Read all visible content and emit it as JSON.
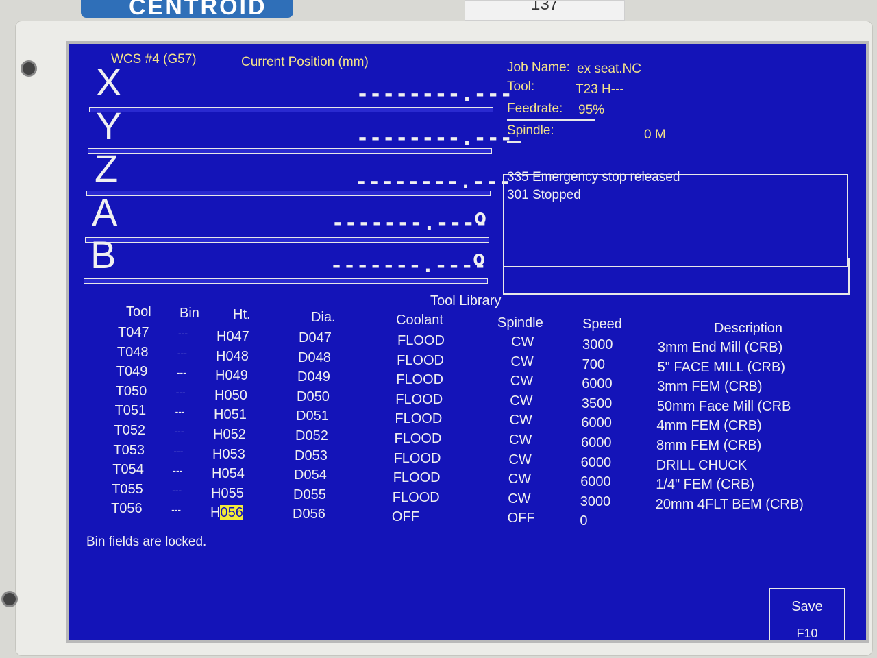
{
  "brand": {
    "logo_text": "CENTROID",
    "tag_text": "137"
  },
  "header": {
    "wcs": "WCS #4 (G57)",
    "position_title": "Current Position (mm)",
    "job_label": "Job Name:",
    "job_value": "ex seat.NC",
    "tool_label": "Tool:",
    "tool_value": "T23 H---",
    "feed_label": "Feedrate:",
    "feed_value": "95%",
    "spindle_label": "Spindle:",
    "spindle_value": "0 M"
  },
  "axes": [
    {
      "letter": "X",
      "value": "--------.---",
      "unit": ""
    },
    {
      "letter": "Y",
      "value": "--------.---",
      "unit": ""
    },
    {
      "letter": "Z",
      "value": "--------.---",
      "unit": ""
    },
    {
      "letter": "A",
      "value": "-------.----",
      "unit": "o"
    },
    {
      "letter": "B",
      "value": "-------.----",
      "unit": "o"
    }
  ],
  "messages": [
    "335 Emergency stop released",
    "301 Stopped"
  ],
  "library": {
    "title": "Tool Library",
    "columns": [
      "Tool",
      "Bin",
      "Ht.",
      "Dia.",
      "Coolant",
      "Spindle",
      "Speed",
      "Description"
    ],
    "rows": [
      [
        "T047",
        "---",
        "H047",
        "D047",
        "FLOOD",
        "CW",
        "3000",
        "3mm End Mill (CRB)"
      ],
      [
        "T048",
        "---",
        "H048",
        "D048",
        "FLOOD",
        "CW",
        "700",
        "5\" FACE MILL (CRB)"
      ],
      [
        "T049",
        "---",
        "H049",
        "D049",
        "FLOOD",
        "CW",
        "6000",
        "3mm FEM (CRB)"
      ],
      [
        "T050",
        "---",
        "H050",
        "D050",
        "FLOOD",
        "CW",
        "3500",
        "50mm Face Mill (CRB"
      ],
      [
        "T051",
        "---",
        "H051",
        "D051",
        "FLOOD",
        "CW",
        "6000",
        "4mm FEM (CRB)"
      ],
      [
        "T052",
        "---",
        "H052",
        "D052",
        "FLOOD",
        "CW",
        "6000",
        "8mm FEM (CRB)"
      ],
      [
        "T053",
        "---",
        "H053",
        "D053",
        "FLOOD",
        "CW",
        "6000",
        "DRILL CHUCK"
      ],
      [
        "T054",
        "---",
        "H054",
        "D054",
        "FLOOD",
        "CW",
        "6000",
        "1/4\" FEM (CRB)"
      ],
      [
        "T055",
        "---",
        "H055",
        "D055",
        "FLOOD",
        "CW",
        "3000",
        "20mm 4FLT BEM (CRB)"
      ],
      [
        "T056",
        "---",
        "H056",
        "D056",
        "OFF",
        "OFF",
        "0",
        ""
      ]
    ],
    "editing_prefix": "H",
    "editing_value": "056"
  },
  "status": "Bin fields are locked.",
  "save": {
    "label": "Save",
    "key": "F10"
  },
  "colors": {
    "screen": "#1414b8",
    "label_yellow": "#f2e28a",
    "highlight": "#f2ea3a"
  }
}
